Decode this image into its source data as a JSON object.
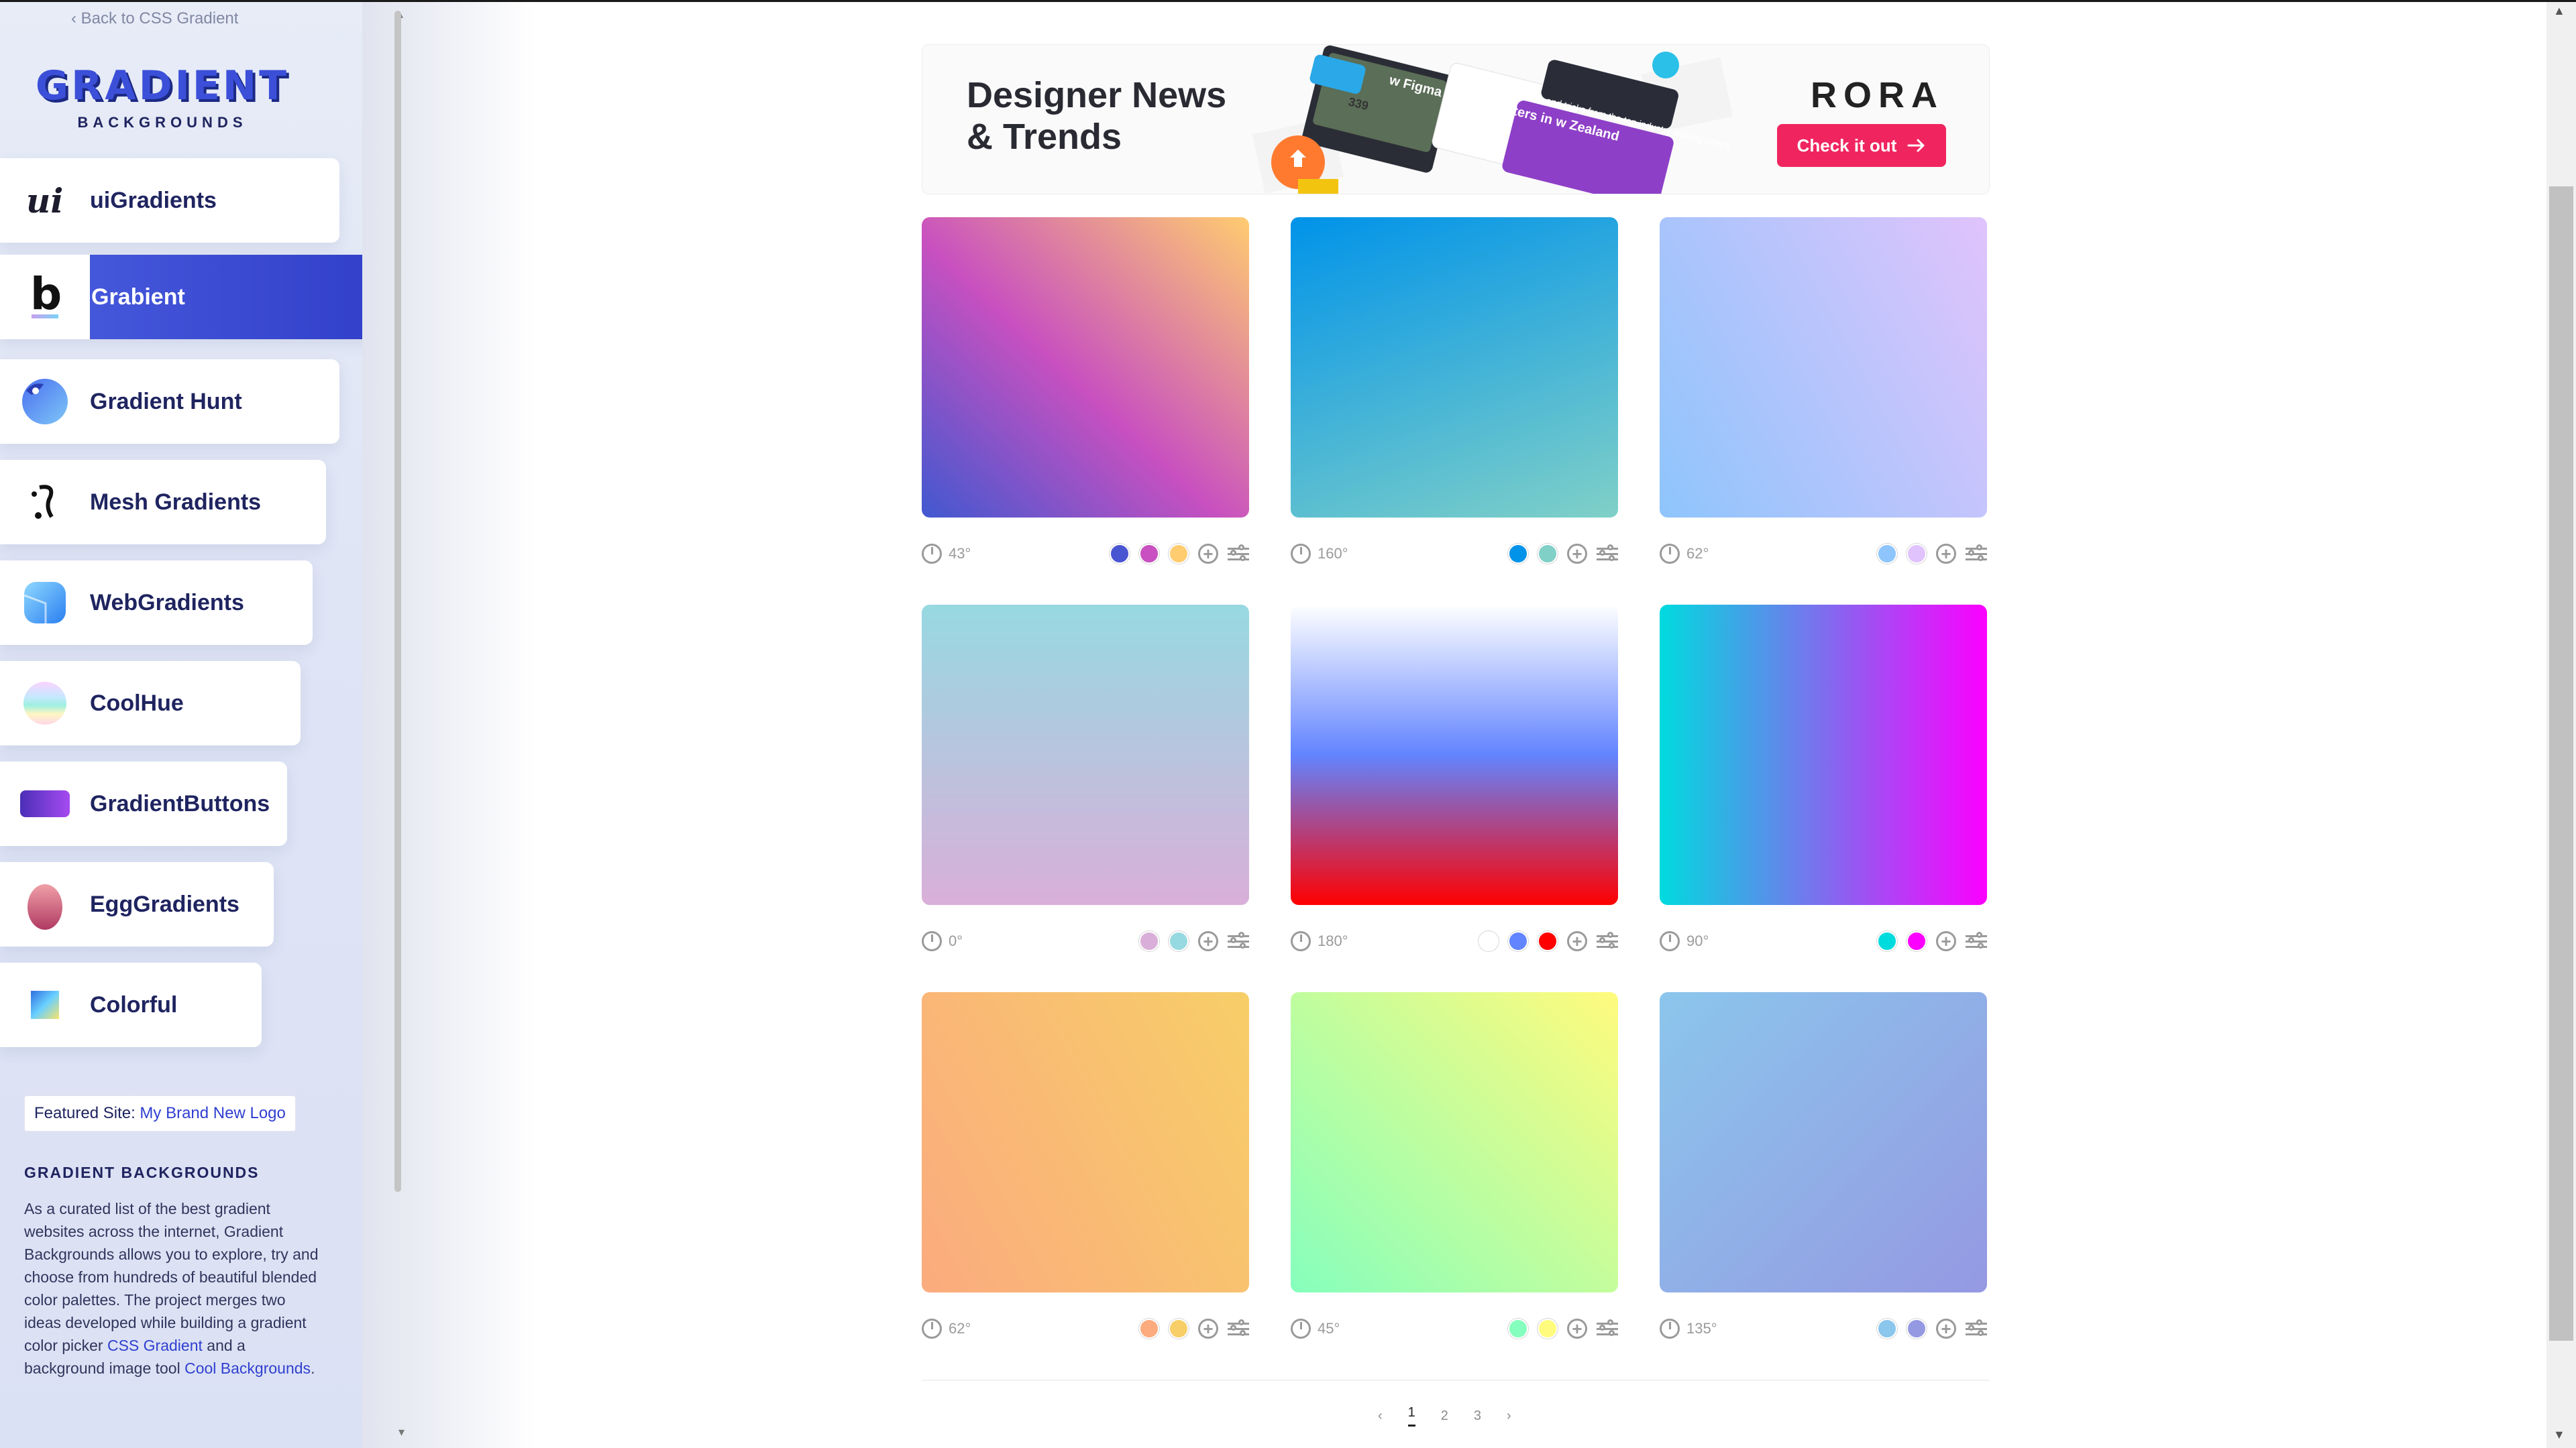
{
  "sidebar": {
    "back_link": "‹ Back to CSS Gradient",
    "logo_main": "GRADIENT",
    "logo_sub": "BACKGROUNDS",
    "items": [
      {
        "label": "uiGradients"
      },
      {
        "label": "Grabient"
      },
      {
        "label": "Gradient Hunt"
      },
      {
        "label": "Mesh Gradients"
      },
      {
        "label": "WebGradients"
      },
      {
        "label": "CoolHue"
      },
      {
        "label": "GradientButtons"
      },
      {
        "label": "EggGradients"
      },
      {
        "label": "Colorful"
      }
    ],
    "active_item": "Grabient",
    "featured_prefix": "Featured Site:",
    "featured_link": "My Brand New Logo",
    "about_title": "GRADIENT BACKGROUNDS",
    "about_text_1": "As a curated list of the best gradient websites across the internet, Gradient Backgrounds allows you to explore, try and choose from hundreds of beautiful blended color palettes. The project merges two ideas developed while building a gradient color picker ",
    "about_link_1": "CSS Gradient",
    "about_text_2": " and a background image tool ",
    "about_link_2": "Cool Backgrounds",
    "about_text_3": "."
  },
  "banner": {
    "title_line1": "Designer News",
    "title_line2": "& Trends",
    "brand": "RORA",
    "button_label": "Check it out",
    "art_text_1": "339",
    "art_text_2": "w Figma Co. adquarters in w Zealand",
    "art_text_3": "Tips and tricks from the top industry leading peeps."
  },
  "gradients": [
    {
      "angle": "43°",
      "colors": [
        "#4a55d1",
        "#c850c0",
        "#ffcc70"
      ],
      "css": "linear-gradient(43deg, #4158D0 0%, #C850C0 46%, #FFCC70 100%)"
    },
    {
      "angle": "160°",
      "colors": [
        "#0093e9",
        "#80d0c7"
      ],
      "css": "linear-gradient(160deg, #0093E9 0%, #80D0C7 100%)"
    },
    {
      "angle": "62°",
      "colors": [
        "#8ec5fc",
        "#e0c3fc"
      ],
      "css": "linear-gradient(62deg, #8EC5FC 0%, #E0C3FC 100%)"
    },
    {
      "angle": "0°",
      "colors": [
        "#d9afd9",
        "#97d9e1"
      ],
      "css": "linear-gradient(0deg, #D9AFD9 0%, #97D9E1 100%)"
    },
    {
      "angle": "180°",
      "colors": [
        "#ffffff",
        "#6284ff",
        "#ff0000"
      ],
      "css": "linear-gradient(180deg, #FFFFFF 0%, #6284FF 50%, #FF0000 100%)"
    },
    {
      "angle": "90°",
      "colors": [
        "#00dbde",
        "#fc00ff"
      ],
      "css": "linear-gradient(90deg, #00DBDE 0%, #FC00FF 100%)"
    },
    {
      "angle": "62°",
      "colors": [
        "#fbab7e",
        "#f7ce68"
      ],
      "css": "linear-gradient(62deg, #FBAB7E 0%, #F7CE68 100%)"
    },
    {
      "angle": "45°",
      "colors": [
        "#85ffbd",
        "#fffb7d"
      ],
      "css": "linear-gradient(45deg, #85FFBD 0%, #FFFB7D 100%)"
    },
    {
      "angle": "135°",
      "colors": [
        "#8bc6ec",
        "#9599e2"
      ],
      "css": "linear-gradient(135deg, #8BC6EC 0%, #9599E2 100%)"
    }
  ],
  "pager": {
    "prev": "‹",
    "pages": [
      "1",
      "2",
      "3"
    ],
    "current": "1",
    "next": "›"
  }
}
